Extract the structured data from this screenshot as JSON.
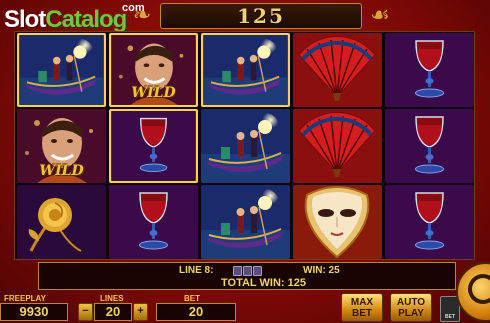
{
  "logo": {
    "part1": "Slot",
    "part2": "Catalog",
    "suffix": "com"
  },
  "top_win": "125",
  "reels": [
    [
      "gondola",
      "wild",
      "rose"
    ],
    [
      "wild",
      "wine-glass",
      "wine-glass"
    ],
    [
      "gondola",
      "gondola",
      "gondola"
    ],
    [
      "fan",
      "fan",
      "mask"
    ],
    [
      "wine-glass",
      "wine-glass",
      "wine-glass"
    ]
  ],
  "highlighted": [
    [
      0,
      0
    ],
    [
      1,
      0
    ],
    [
      1,
      1
    ],
    [
      2,
      0
    ]
  ],
  "wild_text": "WILD",
  "info": {
    "line_label": "LINE 8:",
    "line_win_label": "WIN: 25",
    "total_label": "TOTAL WIN: 125"
  },
  "controls": {
    "freeplay_label": "FREEPLAY",
    "freeplay_value": "9930",
    "lines_label": "LINES",
    "lines_value": "20",
    "minus": "−",
    "plus": "+",
    "bet_label": "BET",
    "bet_value": "20",
    "maxbet_label_1": "MAX",
    "maxbet_label_2": "BET",
    "autoplay_label_1": "AUTO",
    "autoplay_label_2": "PLAY",
    "small_btn_label": "BET"
  },
  "colors": {
    "accent_gold": "#f3c33a",
    "background_red": "#8a0d07",
    "highlight": "#ffd24a"
  }
}
